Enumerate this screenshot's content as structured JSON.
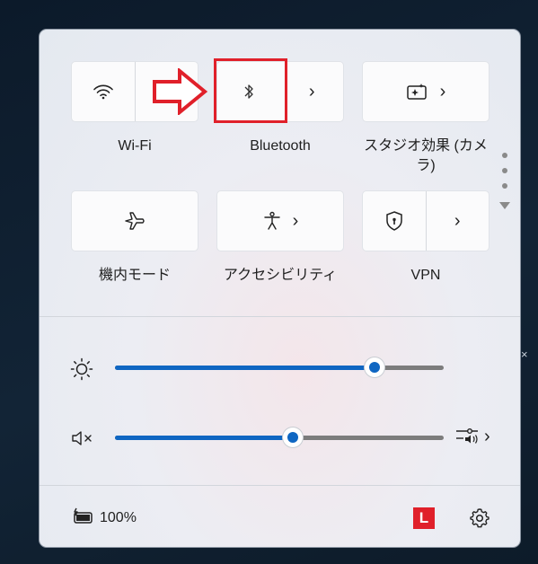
{
  "tiles": {
    "wifi": {
      "label": "Wi-Fi",
      "icon": "wifi-icon"
    },
    "bluetooth": {
      "label": "Bluetooth",
      "icon": "bluetooth-icon"
    },
    "studio": {
      "label": "スタジオ効果 (カメラ)",
      "icon": "studio-effects-icon"
    },
    "airplane": {
      "label": "機内モード",
      "icon": "airplane-icon"
    },
    "accessibility": {
      "label": "アクセシビリティ",
      "icon": "accessibility-icon"
    },
    "vpn": {
      "label": "VPN",
      "icon": "shield-icon"
    }
  },
  "sliders": {
    "brightness": {
      "value_percent": 79,
      "icon": "brightness-icon"
    },
    "volume": {
      "value_percent": 54,
      "icon": "speaker-muted-icon"
    }
  },
  "footer": {
    "battery_text": "100%",
    "app_badge": "L",
    "badge_color": "#e0202a"
  },
  "colors": {
    "accent": "#0f66c2",
    "annotation": "#e0202a"
  }
}
